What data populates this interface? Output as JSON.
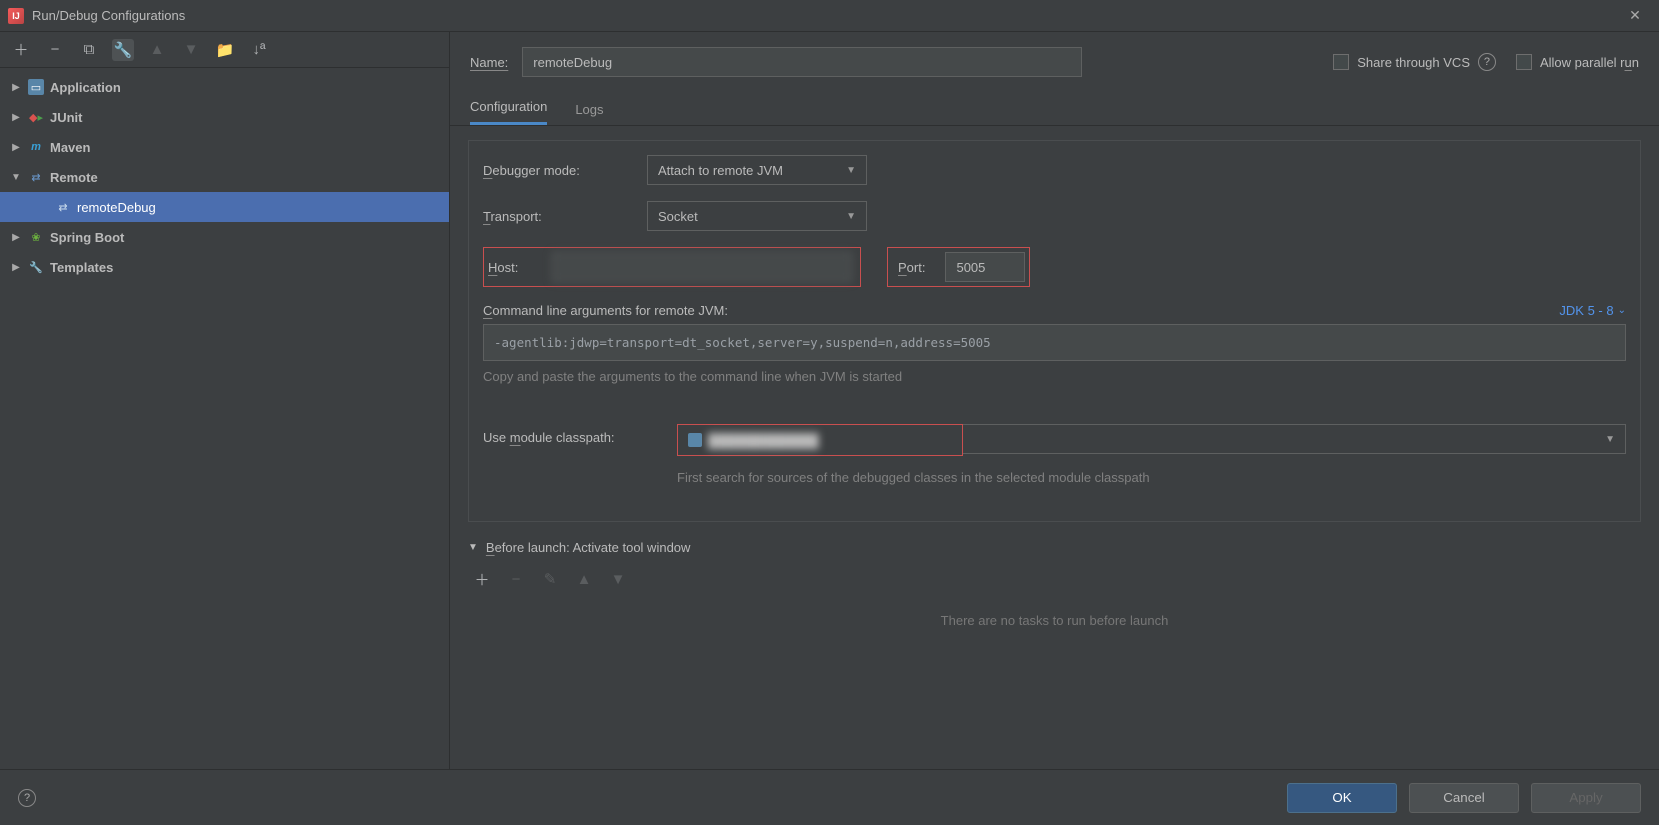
{
  "window": {
    "title": "Run/Debug Configurations"
  },
  "tree": {
    "items": [
      {
        "label": "Application",
        "icon": "app",
        "expanded": false
      },
      {
        "label": "JUnit",
        "icon": "junit",
        "expanded": false
      },
      {
        "label": "Maven",
        "icon": "maven",
        "expanded": false
      },
      {
        "label": "Remote",
        "icon": "remote",
        "expanded": true,
        "children": [
          {
            "label": "remoteDebug",
            "selected": true
          }
        ]
      },
      {
        "label": "Spring Boot",
        "icon": "spring",
        "expanded": false
      },
      {
        "label": "Templates",
        "icon": "templates",
        "expanded": false
      }
    ]
  },
  "header": {
    "name_label": "Name:",
    "name_value": "remoteDebug",
    "share_label": "Share through VCS",
    "parallel_label": "Allow parallel run"
  },
  "tabs": {
    "configuration": "Configuration",
    "logs": "Logs"
  },
  "config": {
    "debugger_mode_label": "Debugger mode:",
    "debugger_mode_value": "Attach to remote JVM",
    "transport_label": "Transport:",
    "transport_value": "Socket",
    "host_label": "Host:",
    "host_value": "",
    "port_label": "Port:",
    "port_value": "5005",
    "cmdline_label": "Command line arguments for remote JVM:",
    "jdk_label": "JDK 5 - 8",
    "cmdline_value": "-agentlib:jdwp=transport=dt_socket,server=y,suspend=n,address=5005",
    "copy_hint": "Copy and paste the arguments to the command line when JVM is started",
    "module_label": "Use module classpath:",
    "module_value": "████████████",
    "module_hint": "First search for sources of the debugged classes in the selected module classpath"
  },
  "before_launch": {
    "title": "Before launch: Activate tool window",
    "empty": "There are no tasks to run before launch"
  },
  "footer": {
    "ok": "OK",
    "cancel": "Cancel",
    "apply": "Apply"
  }
}
